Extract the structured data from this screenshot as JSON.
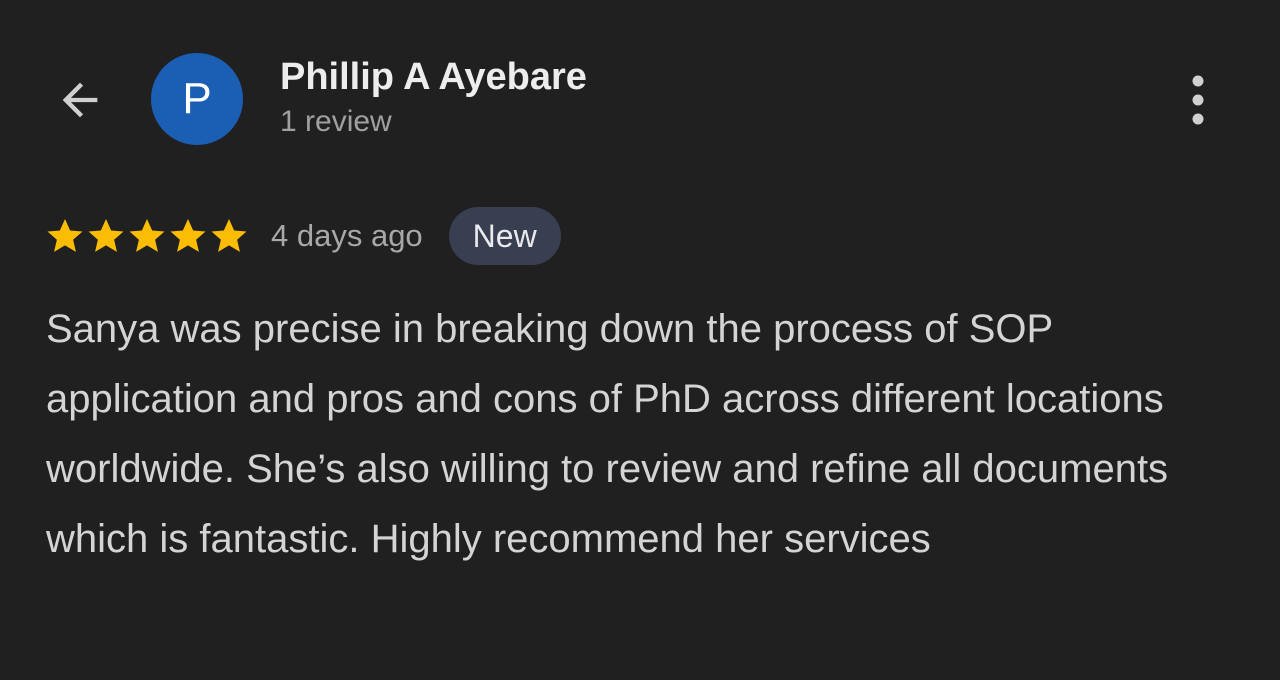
{
  "header": {
    "back_icon": "arrow-back-icon",
    "avatar_letter": "P",
    "avatar_color": "#1a5fb4",
    "reviewer_name": "Phillip A Ayebare",
    "review_count": "1 review",
    "more_icon": "more-vert-icon"
  },
  "review": {
    "rating": 5,
    "rating_max": 5,
    "star_color": "#fbbc04",
    "time_ago": "4 days ago",
    "badge": "New",
    "text": "Sanya was precise in breaking down the process of SOP application and pros and cons of PhD across different locations worldwide. She’s also willing to review and refine all documents which is fantastic. Highly recommend her services"
  }
}
